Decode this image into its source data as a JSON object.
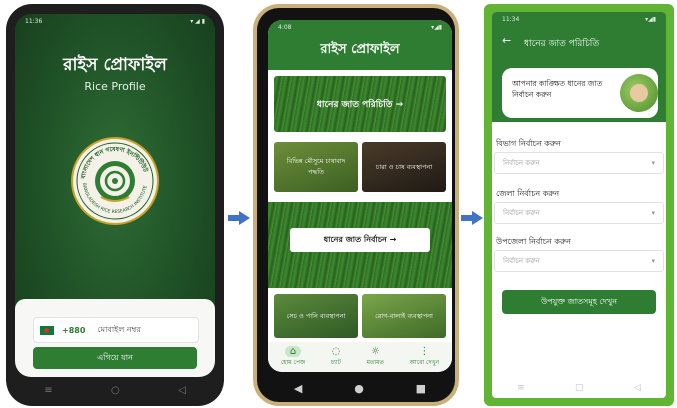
{
  "phone1": {
    "status_time": "11:36",
    "title": "রাইস প্রোফাইল",
    "subtitle": "Rice Profile",
    "logo_ring_text": "বাংলাদেশ ধান গবেষণা ইনস্টিটিউট",
    "logo_ring_text_en": "BANGLADESH RICE RESEARCH INSTITUTE",
    "country_code": "+880",
    "phone_placeholder": "মোবাইল নম্বর",
    "continue_button": "এগিয়ে যান",
    "nav_icons": [
      "menu-icon",
      "home-icon",
      "back-icon"
    ]
  },
  "phone2": {
    "status_time": "4:08",
    "title": "রাইস প্রোফাইল",
    "banner_variety_intro": "ধানের জাত পরিচিতি →",
    "card_cultivation": "বিভিন্ন মৌসুমে চাষাবাদ পদ্ধতি",
    "card_care": "চারা ও চাষ ব্যবস্থাপনা",
    "select_variety_button": "ধানের জাত নির্বাচন →",
    "card_irrigation": "সেচ ও পানি ব্যবস্থাপনা",
    "card_pest": "রোগ-বালাই ব্যবস্থাপনা",
    "tabs": [
      {
        "label": "হোম পেজ",
        "icon": "home-icon"
      },
      {
        "label": "চ্যাট",
        "icon": "chat-icon"
      },
      {
        "label": "মতামত",
        "icon": "bug-icon"
      },
      {
        "label": "আরো দেখুন",
        "icon": "more-icon"
      }
    ]
  },
  "phone3": {
    "status_time": "11:34",
    "header_title": "ধানের জাত পরিচিতি",
    "prompt_text": "আপনার কাঙ্ক্ষিত ধানের জাত নির্বাচন করুন",
    "division_label": "বিভাগ নির্বাচন করুন",
    "district_label": "জেলা নির্বাচন করুন",
    "upazila_label": "উপজেলা নির্বাচন করুন",
    "dropdown_placeholder": "নির্বাচন করুন",
    "submit_button": "উপযুক্ত জাতসমূহ দেখুন"
  },
  "colors": {
    "brand_green": "#2e7d32",
    "frame_green": "#62b534",
    "arrow_blue": "#3f73c4"
  }
}
